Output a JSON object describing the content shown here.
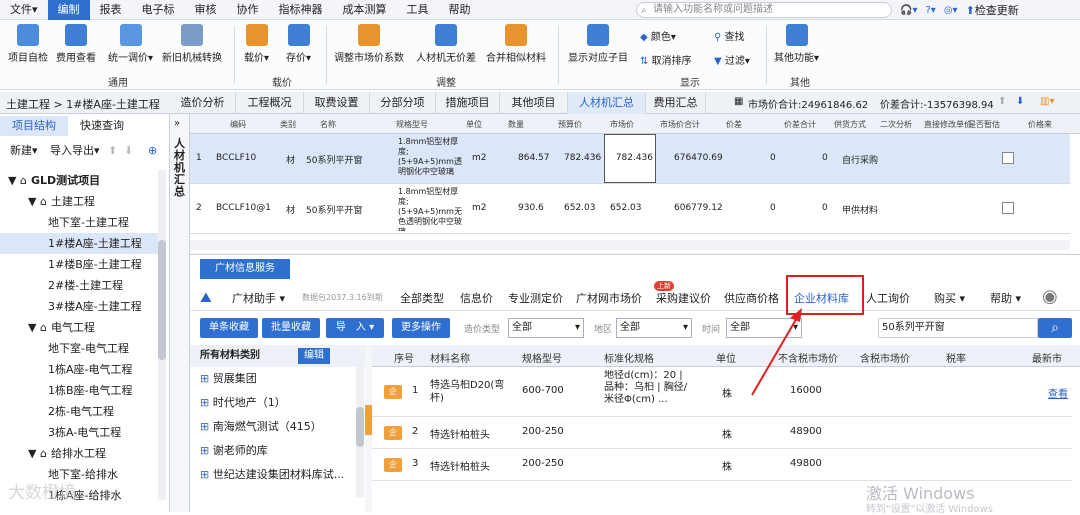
{
  "menu": {
    "items": [
      "文件▾",
      "编制",
      "报表",
      "电子标",
      "审核",
      "协作",
      "指标神器",
      "成本测算",
      "工具",
      "帮助"
    ],
    "active": 1
  },
  "search": {
    "placeholder": "请输入功能名称或问题描述"
  },
  "right_menu": {
    "check_update": "检查更新"
  },
  "ribbon": {
    "buttons": [
      "项目自检",
      "费用查看",
      "统一调价▾",
      "新旧机械转换",
      "载价▾",
      "存价▾",
      "调整市场价系数",
      "人材机无价差",
      "合并相似材料",
      "显示对应子目",
      "其他功能▾"
    ],
    "small_buttons": [
      "颜色▾",
      "取消排序",
      "查找",
      "过滤▾"
    ],
    "groups": [
      "通用",
      "载价",
      "调整",
      "显示",
      "其他"
    ]
  },
  "tabs": {
    "crumb": "土建工程 > 1#楼A座-土建工程",
    "items": [
      "造价分析",
      "工程概况",
      "取费设置",
      "分部分项",
      "措施项目",
      "其他项目",
      "人材机汇总",
      "费用汇总"
    ],
    "active": 6,
    "market_total": "市场价合计:24961846.62",
    "diff_total": "价差合计:-13576398.94"
  },
  "left": {
    "tabs": [
      "项目结构",
      "快速查询"
    ],
    "new_label": "新建▾",
    "import_label": "导入导出▾",
    "tree": [
      {
        "label": "GLD测试项目",
        "level": 0,
        "icon": "▼ ⌂"
      },
      {
        "label": "土建工程",
        "level": 1,
        "icon": "▼ ⌂"
      },
      {
        "label": "地下室-土建工程",
        "level": 2
      },
      {
        "label": "1#楼A座-土建工程",
        "level": 2,
        "selected": true
      },
      {
        "label": "1#楼B座-土建工程",
        "level": 2
      },
      {
        "label": "2#楼-土建工程",
        "level": 2
      },
      {
        "label": "3#楼A座-土建工程",
        "level": 2
      },
      {
        "label": "电气工程",
        "level": 1,
        "icon": "▼ ⌂"
      },
      {
        "label": "地下室-电气工程",
        "level": 2
      },
      {
        "label": "1栋A座-电气工程",
        "level": 2
      },
      {
        "label": "1栋B座-电气工程",
        "level": 2
      },
      {
        "label": "2栋-电气工程",
        "level": 2
      },
      {
        "label": "3栋A-电气工程",
        "level": 2
      },
      {
        "label": "给排水工程",
        "level": 1,
        "icon": "▼ ⌂"
      },
      {
        "label": "地下室-给排水",
        "level": 2
      },
      {
        "label": "1栋A座-给排水",
        "level": 2
      }
    ]
  },
  "side_label": "人材机汇总",
  "grid": {
    "headers": [
      "编码",
      "类别",
      "名称",
      "规格型号",
      "单位",
      "数量",
      "预算价",
      "市场价",
      "市场价合计",
      "价差",
      "价差合计",
      "供货方式",
      "二次分析",
      "直接修改单价",
      "是否暂估",
      "价格来"
    ],
    "rows": [
      {
        "no": "1",
        "code": "BCCLF10",
        "type": "材",
        "name": "50系列平开窗",
        "spec": "1.8mm铝型材厚度;(5+9A+5)mm透明钢化中空玻璃",
        "unit": "m2",
        "qty": "864.57",
        "budget": "782.436",
        "market": "782.436",
        "total": "676470.69",
        "diff": "0",
        "difftotal": "0",
        "supply": "自行采购"
      },
      {
        "no": "2",
        "code": "BCCLF10@1",
        "type": "材",
        "name": "50系列平开窗",
        "spec": "1.8mm铝型材厚度;(5+9A+5)mm无色透明钢化中空玻璃",
        "unit": "m2",
        "qty": "930.6",
        "budget": "652.03",
        "market": "652.03",
        "total": "606779.12",
        "diff": "0",
        "difftotal": "0",
        "supply": "甲供材料"
      }
    ]
  },
  "panel": {
    "title": "广材信息服务",
    "assistant": "广材助手 ▾",
    "version": "数据包2037.3.16到期",
    "nav": [
      "全部类型",
      "信息价",
      "专业测定价",
      "广材网市场价",
      "采购建议价",
      "供应商价格",
      "企业材料库",
      "人工询价",
      "购买 ▾",
      "帮助 ▾"
    ],
    "new_badge": "上新",
    "buttons": [
      "单条收藏",
      "批量收藏",
      "导　入 ▾",
      "更多操作"
    ],
    "filters": [
      {
        "label": "造价类型",
        "value": "全部"
      },
      {
        "label": "地区",
        "value": "全部"
      },
      {
        "label": "时间",
        "value": "全部"
      }
    ],
    "keyword": "50系列平开窗",
    "cat_header": "所有材料类别",
    "edit_label": "编辑",
    "categories": [
      "贸展集团",
      "时代地产（1）",
      "南海燃气测试（415）",
      "谢老师的库",
      "世纪达建设集团材料库试..."
    ],
    "mat_headers": [
      "序号",
      "材料名称",
      "规格型号",
      "标准化规格",
      "单位",
      "不含税市场价",
      "含税市场价",
      "税率",
      "最新市"
    ],
    "mat_rows": [
      {
        "no": "1",
        "name": "特选乌桕D20(弯杆)",
        "spec": "600-700",
        "std": "地径d(cm)：20 | 品种：乌桕 | 胸径/米径Φ(cm) ...",
        "unit": "株",
        "price": "16000",
        "link": "查看"
      },
      {
        "no": "2",
        "name": "特选针柏桩头",
        "spec": "200-250",
        "std": "",
        "unit": "株",
        "price": "48900",
        "link": ""
      },
      {
        "no": "3",
        "name": "特选针柏桩头",
        "spec": "200-250",
        "std": "",
        "unit": "株",
        "price": "49800",
        "link": ""
      }
    ],
    "mat_badge": "企"
  },
  "watermark": {
    "line1": "激活 Windows",
    "line2": "转到\"设置\"以激活 Windows"
  },
  "logo": "大数橙境"
}
